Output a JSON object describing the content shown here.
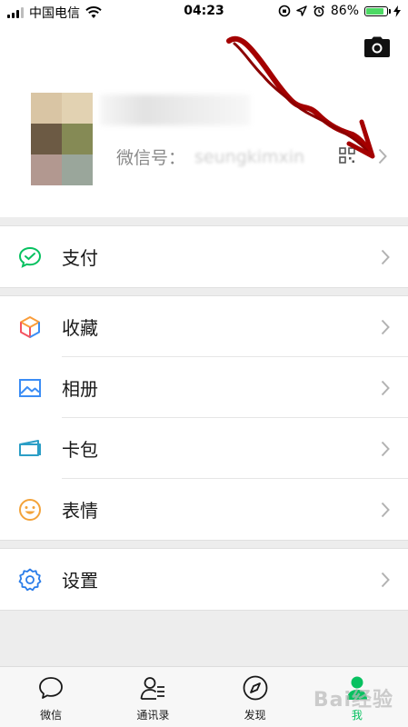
{
  "status_bar": {
    "carrier": "中国电信",
    "time": "04:23",
    "battery_percent": "86%",
    "battery_level": 0.86
  },
  "profile": {
    "wechat_id_label": "微信号：",
    "wechat_id_value": "seungkimxin"
  },
  "menu": {
    "pay": {
      "label": "支付",
      "icon": "wechat-pay-icon"
    },
    "favorites": {
      "label": "收藏",
      "icon": "favorites-cube-icon"
    },
    "album": {
      "label": "相册",
      "icon": "album-icon"
    },
    "card_package": {
      "label": "卡包",
      "icon": "card-package-icon"
    },
    "stickers": {
      "label": "表情",
      "icon": "smiley-icon"
    },
    "settings": {
      "label": "设置",
      "icon": "gear-icon"
    }
  },
  "tab_bar": {
    "tabs": [
      {
        "label": "微信",
        "icon": "chat-bubble-icon"
      },
      {
        "label": "通讯录",
        "icon": "contacts-icon"
      },
      {
        "label": "发现",
        "icon": "compass-icon"
      },
      {
        "label": "我",
        "icon": "person-icon"
      }
    ],
    "active_index": 3
  },
  "watermark": {
    "text": "Bai经验"
  },
  "colors": {
    "accent_green": "#07c160",
    "background": "#ededed",
    "annotation_red": "#a40000"
  }
}
